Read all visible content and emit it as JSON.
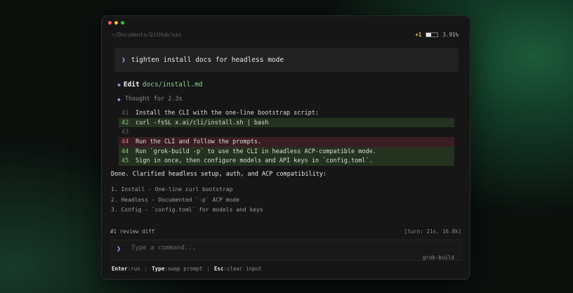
{
  "window": {
    "path": "~/Documents/GitHub/xai",
    "status": {
      "plus": "+1",
      "context_percent": "3.91%",
      "context_fill": 0.4
    }
  },
  "prompt": {
    "text": "tighten install docs for headless mode"
  },
  "edit": {
    "label": "Edit",
    "path": "docs/install.md"
  },
  "thought": {
    "text": "Thought for 2.3s"
  },
  "diff": [
    {
      "ln": "41",
      "kind": "ctx",
      "text": "Install the CLI with the one-line bootstrap script:"
    },
    {
      "ln": "42",
      "kind": "add",
      "text": "curl -fsSL x.ai/cli/install.sh | bash"
    },
    {
      "ln": "43",
      "kind": "ctx",
      "text": ""
    },
    {
      "ln": "44",
      "kind": "del",
      "text": "Run the CLI and follow the prompts."
    },
    {
      "ln": "44",
      "kind": "add",
      "text": "Run `grok-build -p` to use the CLI in headless ACP-compatible mode."
    },
    {
      "ln": "45",
      "kind": "add",
      "text": "Sign in once, then configure models and API keys in `config.toml`."
    }
  ],
  "summary": {
    "done": "Done. Clarified headless setup, auth, and ACP compatibility:",
    "items": [
      "1. Install - One-line curl bootstrap",
      "2. Headless - Documented `-p` ACP mode",
      "3. Config - `config.toml` for models and keys"
    ]
  },
  "footer": {
    "review": "#1 review diff",
    "turn": "[turn: 21s, 16.8k]",
    "command_placeholder": "Type a command...",
    "agent": "grok-build",
    "hints": [
      {
        "key": "Enter",
        "action": ":run"
      },
      {
        "key": "Type",
        "action": ":swap prompt"
      },
      {
        "key": "Esc",
        "action": ":clear input"
      }
    ]
  },
  "colors": {
    "accent": "#8fb3ff",
    "add_bg": "#24331f",
    "del_bg": "#3a1d22",
    "edit_path": "#8dd18a"
  }
}
